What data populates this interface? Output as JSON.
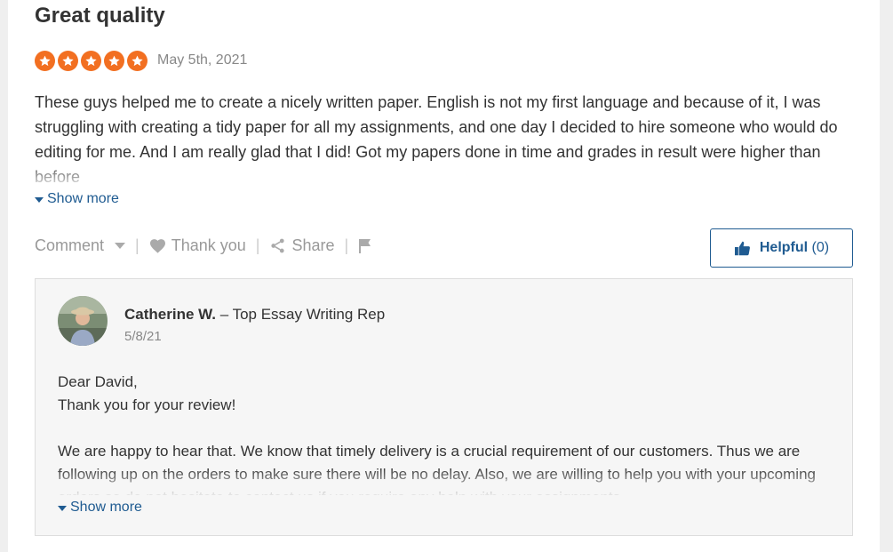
{
  "review": {
    "title": "Great quality",
    "rating": 5,
    "rating_max": 5,
    "date": "May 5th, 2021",
    "body": "These guys helped me to create a nicely written paper. English is not my first language and because of it, I was struggling with creating a tidy paper for all my assignments, and one day I decided to hire someone who would do editing for me. And I am really glad that I did! Got my papers done in time and grades in result were higher than before",
    "show_more_label": "Show more"
  },
  "actions": {
    "comment_label": "Comment",
    "thank_label": "Thank you",
    "share_label": "Share",
    "helpful_label": "Helpful",
    "helpful_count": "(0)"
  },
  "reply": {
    "author": "Catherine W.",
    "role": "– Top Essay Writing Rep",
    "date": "5/8/21",
    "greeting": "Dear David,",
    "thanks": "Thank you for your review!",
    "body": "We are happy to hear that. We know that timely delivery is a crucial requirement of our customers. Thus we are following up on the orders to make sure there will be no delay. Also, we are willing to help you with your upcoming orders so do not hesitate to contact us if you require any help with your assignments.",
    "show_more_label": "Show more"
  },
  "colors": {
    "star": "#f26f21",
    "link": "#1f5b91",
    "muted": "#999999"
  }
}
